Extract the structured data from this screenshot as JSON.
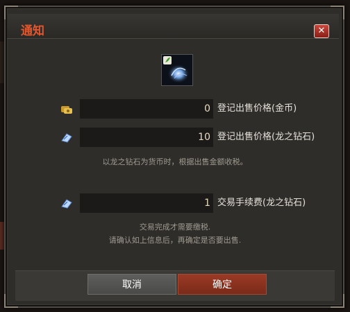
{
  "dialog": {
    "title": "通知",
    "close_icon": "close-x-icon"
  },
  "item": {
    "icon": "dragon-diamond-item-icon"
  },
  "rows": [
    {
      "icon": "gold-coin-icon",
      "value": "0",
      "label": "登记出售价格(金币)"
    },
    {
      "icon": "dragon-diamond-icon",
      "value": "10",
      "label": "登记出售价格(龙之钻石)"
    }
  ],
  "tax_note": "以龙之钻石为货币时，根据出售金额收税。",
  "fee_row": {
    "icon": "dragon-diamond-icon",
    "value": "1",
    "label": "交易手续费(龙之钻石)"
  },
  "confirm_notes": [
    "交易完成才需要缴税.",
    "请确认如上信息后，再确定是否要出售."
  ],
  "buttons": {
    "cancel": "取消",
    "ok": "确定"
  },
  "colors": {
    "title": "#e2562e",
    "ok_button": "#8a3320",
    "cancel_button": "#555553",
    "panel": "#2e2d2a"
  }
}
